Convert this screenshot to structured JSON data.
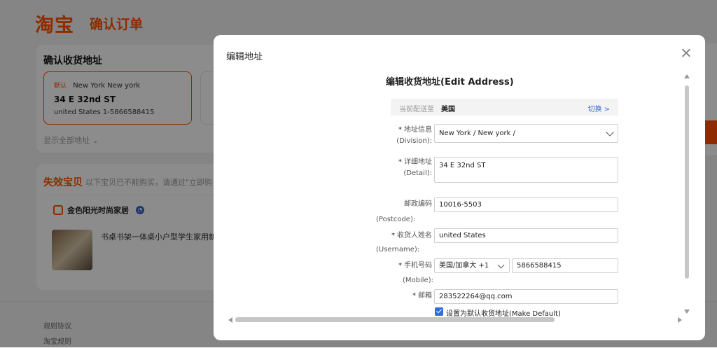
{
  "header": {
    "logo": "淘宝",
    "title": "确认订单"
  },
  "address_card": {
    "title": "确认收货地址",
    "selected": {
      "tag": "默认",
      "region": "New York New york",
      "street": "34 E 32nd ST",
      "contact": "united States  1-5866588415"
    },
    "show_all": "显示全部地址"
  },
  "invalid_card": {
    "title": "失效宝贝",
    "subtitle": "以下宝贝已不能购买，请通过\"立即购",
    "shop_name": "金色阳光时尚家居",
    "product_title": "书桌书架一体桌小户型学生家用新"
  },
  "footer": {
    "rules": "规则协议",
    "taobao_rules": "淘宝规则"
  },
  "modal": {
    "title": "编辑地址",
    "form_title": "编辑收货地址(Edit Address)",
    "ship_to_label": "当前配送至",
    "ship_to_value": "美国",
    "switch_label": "切换 >",
    "division": {
      "label": "地址信息",
      "sub": "(Division):",
      "value": "New York  /  New york  /"
    },
    "detail": {
      "label": "详细地址",
      "sub": "(Detail):",
      "value": "34 E 32nd ST"
    },
    "postcode": {
      "label": "邮政编码",
      "sub": "(Postcode):",
      "value": "10016-5503"
    },
    "username": {
      "label": "收货人姓名",
      "sub": "(Username):",
      "value": "united States"
    },
    "mobile": {
      "label": "手机号码",
      "sub": "(Mobile):",
      "country_code": "美国/加拿大 +1",
      "value": "5866588415"
    },
    "email": {
      "label": "邮箱",
      "value": "283522264@qq.com"
    },
    "make_default": "设置为默认收货地址(Make Default)"
  },
  "colors": {
    "accent": "#ff5000",
    "link": "#3a6fd8",
    "checkbox": "#2f6fe0"
  }
}
